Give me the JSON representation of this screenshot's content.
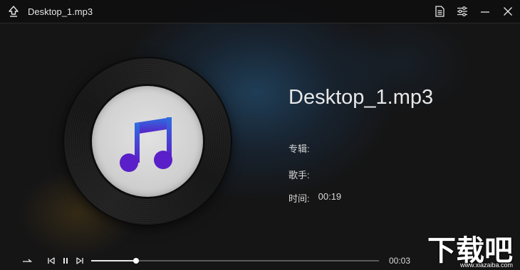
{
  "window": {
    "title": "Desktop_1.mp3"
  },
  "track": {
    "title": "Desktop_1.mp3",
    "album_label": "专辑:",
    "album_value": "",
    "artist_label": "歌手:",
    "artist_value": "",
    "duration_label": "时间:",
    "duration_value": "00:19"
  },
  "playback": {
    "current_time": "00:03",
    "progress_fraction": 0.155
  },
  "icons": {
    "app": "up-arrow-eject-icon",
    "playlist": "document-list-icon",
    "equalizer": "sliders-icon",
    "minimize": "minimize-icon",
    "close": "close-icon",
    "cover": "music-note-icon",
    "mode": "sequence-arrow-icon",
    "prev": "skip-previous-icon",
    "pause": "pause-icon",
    "next": "skip-next-icon"
  },
  "watermark": {
    "text": "下载吧",
    "url": "www.xiazaiba.com"
  },
  "colors": {
    "note_top": "#2f6ee0",
    "note_bottom": "#5a1fc8",
    "accent_blue": "#285f8c"
  }
}
